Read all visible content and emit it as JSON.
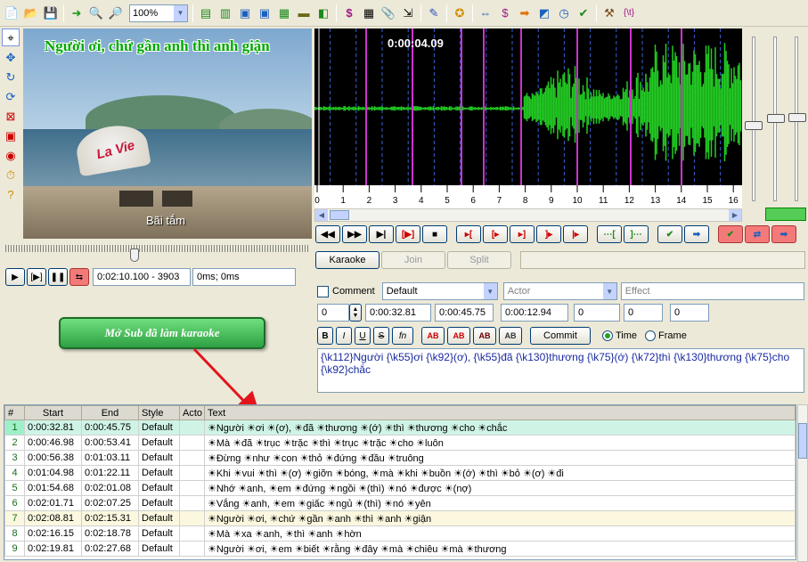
{
  "toolbar": {
    "zoom_value": "100%",
    "icons": [
      "new-file-icon",
      "open-folder-icon",
      "save-icon",
      "play-arrow-icon",
      "zoom-in-icon",
      "zoom-out-icon",
      "layout-icon",
      "layout-icon",
      "monitor-icon",
      "monitor-icon",
      "subtitles-icon",
      "audio-icon",
      "movie-icon",
      "styles-icon",
      "calculator-icon",
      "attach-icon",
      "export-icon",
      "translate-icon",
      "globe-icon",
      "timing-icon",
      "effect-icon",
      "arrow-icon",
      "resample-icon",
      "clock-icon",
      "check-icon",
      "hammer-icon",
      "tag-icon"
    ]
  },
  "video": {
    "karaoke_line": "Người ơi, chứ gần anh thì anh giận",
    "brand_text": "La Vie",
    "caption": "Bãi tắm"
  },
  "playback": {
    "position": "0:02:10.100 - 3903",
    "offset": "0ms; 0ms"
  },
  "waveform": {
    "time": "0:00:04.09",
    "ruler_labels": [
      "0",
      "1",
      "2",
      "3",
      "4",
      "5",
      "6",
      "7",
      "8",
      "9",
      "10",
      "11",
      "12",
      "13",
      "14",
      "15",
      "16"
    ],
    "colors": {
      "wave": "#22cc22",
      "marker": "#cc33cc",
      "grid": "#3a5fd0"
    }
  },
  "karaoke_buttons": {
    "karaoke": "Karaoke",
    "join": "Join",
    "split": "Split"
  },
  "editor": {
    "comment_label": "Comment",
    "style": "Default",
    "actor_placeholder": "Actor",
    "effect_placeholder": "Effect",
    "layer": "0",
    "start": "0:00:32.81",
    "end": "0:00:45.75",
    "duration": "0:00:12.94",
    "margin_l": "0",
    "margin_r": "0",
    "margin_v": "0",
    "format_buttons": [
      "B",
      "I",
      "U",
      "S",
      "fn",
      "AB",
      "AB",
      "AB",
      "AB"
    ],
    "commit": "Commit",
    "time_label": "Time",
    "frame_label": "Frame",
    "text": "{\\k112}Người {\\k55}ơi {\\k92}(ơ), {\\k55}đã {\\k130}thương {\\k75}(ớ) {\\k72}thì {\\k130}thương {\\k75}cho {\\k92}chắc"
  },
  "callout": "Mở Sub đã làm karaoke",
  "grid": {
    "headers": [
      "#",
      "Start",
      "End",
      "Style",
      "Acto",
      "Text"
    ],
    "rows": [
      {
        "n": "1",
        "start": "0:00:32.81",
        "end": "0:00:45.75",
        "style": "Default",
        "actor": "",
        "text": "☀Người ☀ơi ☀(ơ), ☀đã ☀thương ☀(ớ) ☀thì ☀thương ☀cho ☀chắc"
      },
      {
        "n": "2",
        "start": "0:00:46.98",
        "end": "0:00:53.41",
        "style": "Default",
        "actor": "",
        "text": "☀Mà ☀đã ☀trục ☀trặc ☀thì ☀trục ☀trặc ☀cho ☀luôn"
      },
      {
        "n": "3",
        "start": "0:00:56.38",
        "end": "0:01:03.11",
        "style": "Default",
        "actor": "",
        "text": "☀Đừng ☀như ☀con ☀thỏ ☀đứng ☀đầu ☀truông"
      },
      {
        "n": "4",
        "start": "0:01:04.98",
        "end": "0:01:22.11",
        "style": "Default",
        "actor": "",
        "text": "☀Khi ☀vui ☀thì ☀(ơ) ☀giỡn ☀bóng, ☀mà ☀khi ☀buồn ☀(ớ) ☀thì ☀bỏ ☀(ơ) ☀đi"
      },
      {
        "n": "5",
        "start": "0:01:54.68",
        "end": "0:02:01.08",
        "style": "Default",
        "actor": "",
        "text": "☀Nhớ ☀anh, ☀em ☀đứng ☀ngồi ☀(thì) ☀nó ☀được ☀(nợ)"
      },
      {
        "n": "6",
        "start": "0:02:01.71",
        "end": "0:02:07.25",
        "style": "Default",
        "actor": "",
        "text": "☀Vắng ☀anh, ☀em ☀giấc ☀ngủ ☀(thì) ☀nó ☀yên"
      },
      {
        "n": "7",
        "start": "0:02:08.81",
        "end": "0:02:15.31",
        "style": "Default",
        "actor": "",
        "text": "☀Người ☀ơi, ☀chứ ☀gần ☀anh ☀thì ☀anh ☀giận"
      },
      {
        "n": "8",
        "start": "0:02:16.15",
        "end": "0:02:18.78",
        "style": "Default",
        "actor": "",
        "text": "☀Mà ☀xa ☀anh, ☀thì ☀anh ☀hờn"
      },
      {
        "n": "9",
        "start": "0:02:19.81",
        "end": "0:02:27.68",
        "style": "Default",
        "actor": "",
        "text": "☀Người ☀ơi, ☀em ☀biết ☀rằng ☀đây ☀mà ☀chiêu ☀mà ☀thương"
      }
    ]
  }
}
